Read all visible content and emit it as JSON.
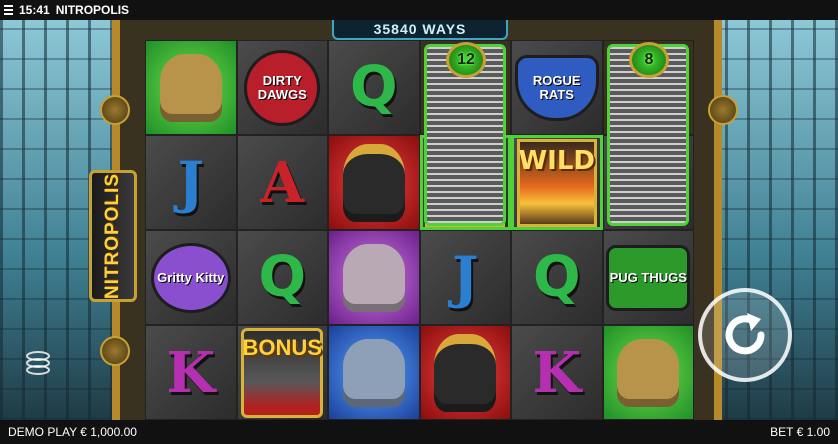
{
  "status": {
    "time": "15:41",
    "title": "NITROPOLIS"
  },
  "ways_label": "35840 WAYS",
  "logo_text": "NITROPOLIS",
  "towers": [
    {
      "count": "12"
    },
    {
      "count": "8"
    }
  ],
  "reels": [
    [
      {
        "type": "pug",
        "bg": "green"
      },
      {
        "type": "letter",
        "text": "J",
        "style": "j"
      },
      {
        "type": "emblem",
        "text": "Gritty Kitty",
        "style": "kitty"
      },
      {
        "type": "letter",
        "text": "K",
        "style": "k"
      }
    ],
    [
      {
        "type": "emblem",
        "text": "DIRTY DAWGS",
        "style": "dawgs"
      },
      {
        "type": "letter",
        "text": "A",
        "style": "a"
      },
      {
        "type": "letter",
        "text": "Q",
        "style": "q"
      },
      {
        "type": "bonus",
        "text": "BONUS"
      }
    ],
    [
      {
        "type": "letter",
        "text": "Q",
        "style": "q"
      },
      {
        "type": "dog",
        "bg": "red"
      },
      {
        "type": "cat",
        "bg": "purple"
      },
      {
        "type": "rat",
        "bg": "blue"
      }
    ],
    [
      {
        "type": "tower-top"
      },
      {
        "type": "wild",
        "text": "WILD"
      },
      {
        "type": "letter",
        "text": "J",
        "style": "j"
      },
      {
        "type": "dog",
        "bg": "red"
      }
    ],
    [
      {
        "type": "emblem",
        "text": "ROGUE RATS",
        "style": "rats"
      },
      {
        "type": "wild",
        "text": "WILD"
      },
      {
        "type": "letter",
        "text": "Q",
        "style": "q"
      },
      {
        "type": "letter",
        "text": "K",
        "style": "k"
      }
    ],
    [
      {
        "type": "tower-top"
      },
      {
        "type": "letter",
        "text": "Q",
        "style": "q"
      },
      {
        "type": "emblem",
        "text": "PUG THUGS",
        "style": "thugs"
      },
      {
        "type": "pug",
        "bg": "green"
      }
    ]
  ],
  "bottom": {
    "balance_label": "DEMO PLAY € 1,000.00",
    "bet_label": "BET € 1.00"
  },
  "icons": {
    "menu": "hamburger-icon",
    "spin": "spin-arrow-icon",
    "stack": "coin-stack-icon"
  }
}
